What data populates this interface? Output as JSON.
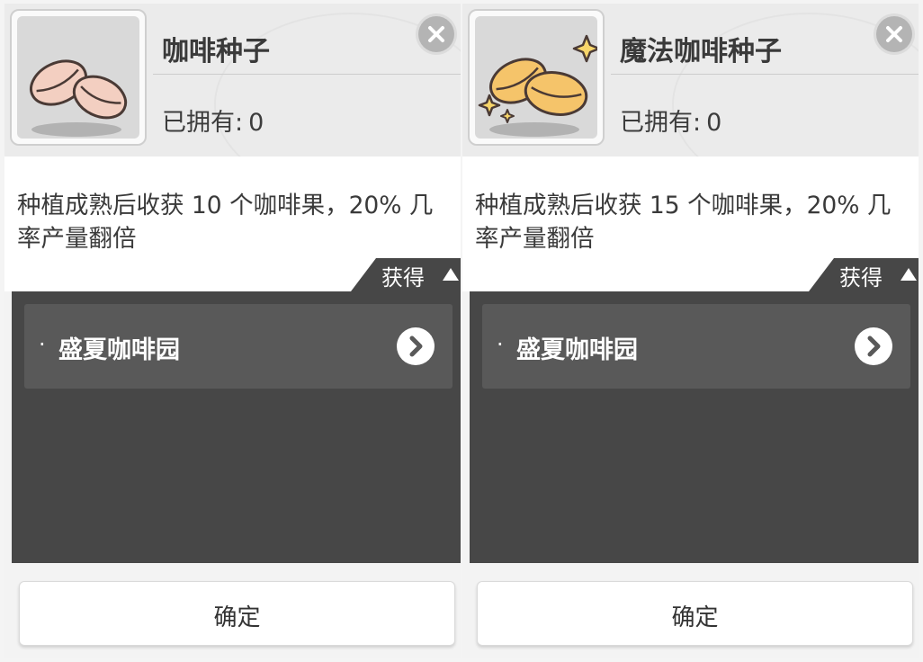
{
  "colors": {
    "header_bg": "#ebebeb",
    "dark_panel": "#474747",
    "source_row": "#595959",
    "seed_plain": "#f3cfc1",
    "seed_magic": "#f5c46a",
    "sparkle": "#f7d56a"
  },
  "panels": [
    {
      "title": "咖啡种子",
      "owned_label": "已拥有:",
      "owned_value": "0",
      "description": "种植成熟后收获 10 个咖啡果，20% 几率产量翻倍",
      "acquire_label": "获得",
      "source_bullet": "·",
      "source_name": "盛夏咖啡园",
      "confirm_label": "确定",
      "icon": "coffee-seed-icon"
    },
    {
      "title": "魔法咖啡种子",
      "owned_label": "已拥有:",
      "owned_value": "0",
      "description": "种植成熟后收获 15 个咖啡果，20% 几率产量翻倍",
      "acquire_label": "获得",
      "source_bullet": "·",
      "source_name": "盛夏咖啡园",
      "confirm_label": "确定",
      "icon": "magic-coffee-seed-icon"
    }
  ]
}
